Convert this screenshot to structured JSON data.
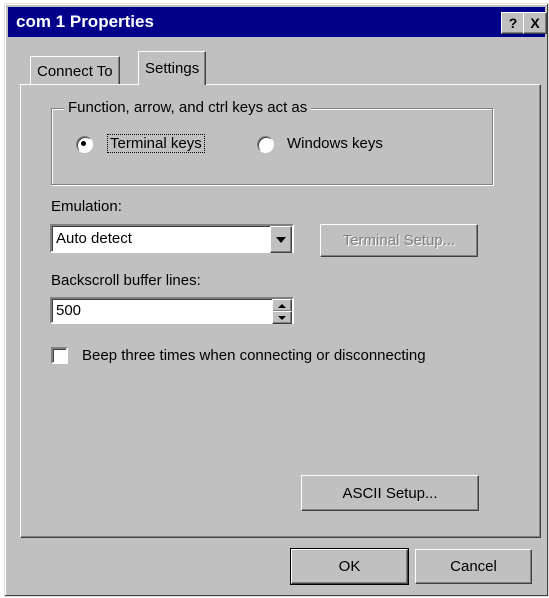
{
  "window": {
    "title": "com 1 Properties",
    "help_label": "?",
    "close_label": "X"
  },
  "tabs": [
    {
      "label": "Connect To",
      "active": false
    },
    {
      "label": "Settings",
      "active": true
    }
  ],
  "keys_group": {
    "legend": "Function, arrow, and ctrl keys act as",
    "options": [
      {
        "label": "Terminal keys",
        "selected": true
      },
      {
        "label": "Windows keys",
        "selected": false
      }
    ]
  },
  "emulation": {
    "label": "Emulation:",
    "value": "Auto detect",
    "setup_button": "Terminal Setup..."
  },
  "backscroll": {
    "label": "Backscroll buffer lines:",
    "value": "500"
  },
  "beep": {
    "label": "Beep three times when connecting or disconnecting",
    "checked": false
  },
  "ascii_button": "ASCII Setup...",
  "footer": {
    "ok": "OK",
    "cancel": "Cancel"
  }
}
